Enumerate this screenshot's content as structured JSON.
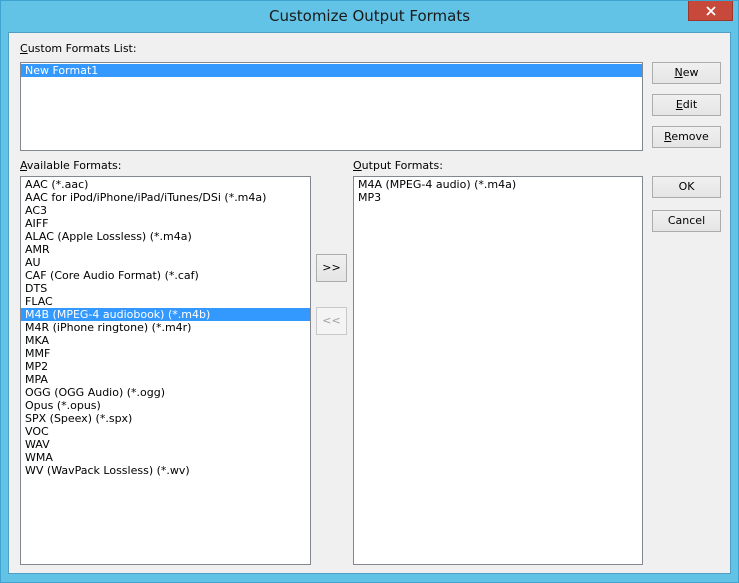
{
  "window": {
    "title": "Customize Output Formats"
  },
  "custom": {
    "label_key": "C",
    "label_rest": "ustom Formats List:",
    "items": [
      "New Format1"
    ]
  },
  "available": {
    "label_key": "A",
    "label_rest": "vailable Formats:",
    "items": [
      "AAC (*.aac)",
      "AAC for iPod/iPhone/iPad/iTunes/DSi (*.m4a)",
      "AC3",
      "AIFF",
      "ALAC (Apple Lossless) (*.m4a)",
      "AMR",
      "AU",
      "CAF (Core Audio Format) (*.caf)",
      "DTS",
      "FLAC",
      "M4B (MPEG-4 audiobook) (*.m4b)",
      "M4R (iPhone ringtone) (*.m4r)",
      "MKA",
      "MMF",
      "MP2",
      "MPA",
      "OGG (OGG Audio) (*.ogg)",
      "Opus (*.opus)",
      "SPX (Speex) (*.spx)",
      "VOC",
      "WAV",
      "WMA",
      "WV (WavPack Lossless) (*.wv)"
    ],
    "selected": "M4B (MPEG-4 audiobook) (*.m4b)"
  },
  "output": {
    "label_key": "O",
    "label_rest": "utput Formats:",
    "items": [
      "M4A (MPEG-4 audio) (*.m4a)",
      "MP3"
    ]
  },
  "buttons": {
    "new_key": "N",
    "new_rest": "ew",
    "edit_key": "E",
    "edit_rest": "dit",
    "remove_key": "R",
    "remove_rest": "emove",
    "ok": "OK",
    "cancel": "Cancel",
    "add": ">>",
    "remove_item": "<<"
  },
  "colors": {
    "selection": "#3399ff",
    "close": "#c7493b",
    "frame": "#62c3e6"
  }
}
